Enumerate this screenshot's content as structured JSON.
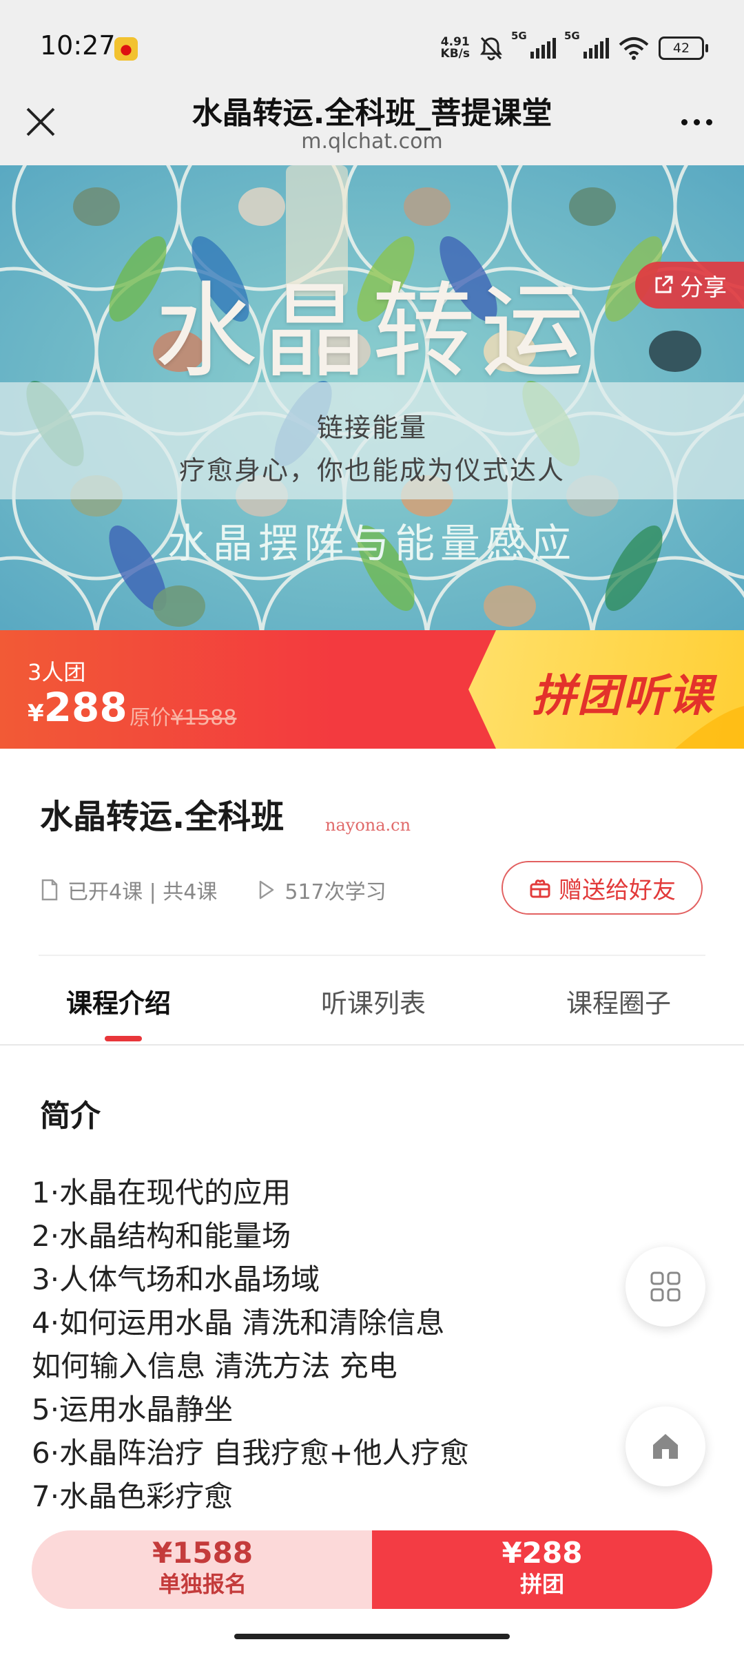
{
  "status_bar": {
    "time": "10:27",
    "net_speed_value": "4.91",
    "net_speed_unit": "KB/s",
    "sim1": "5G",
    "sim2": "5G",
    "battery": "42"
  },
  "title_bar": {
    "title": "水晶转运.全科班_菩提课堂",
    "url": "m.qlchat.com"
  },
  "banner": {
    "title": "水晶转运",
    "line1": "链接能量",
    "line2": "疗愈身心，你也能成为仪式达人",
    "subtitle": "水晶摆阵与能量感应",
    "share_label": "分享"
  },
  "price_strip": {
    "group_size": "3人团",
    "currency": "¥",
    "group_price": "288",
    "original_label": "原价",
    "original_price": "¥1588",
    "cta_label": "拼团听课"
  },
  "course": {
    "title": "水晶转运.全科班",
    "watermark": "nayona.cn",
    "lessons": "已开4课 | 共4课",
    "views": "517次学习",
    "gift_label": "赠送给好友"
  },
  "tabs": [
    {
      "label": "课程介绍",
      "active": true
    },
    {
      "label": "听课列表",
      "active": false
    },
    {
      "label": "课程圈子",
      "active": false
    }
  ],
  "intro": {
    "heading": "简介",
    "lines": [
      "1·水晶在现代的应用",
      "2·水晶结构和能量场",
      "3·人体气场和水晶场域",
      "4·如何运用水晶 清洗和清除信息",
      "如何输入信息 清洗方法 充电",
      "5·运用水晶静坐",
      "6·水晶阵治疗 自我疗愈+他人疗愈",
      "7·水晶色彩疗愈"
    ]
  },
  "bottom_bar": {
    "solo_price": "¥1588",
    "solo_label": "单独报名",
    "group_price": "¥288",
    "group_label": "拼团"
  },
  "colors": {
    "accent_red": "#f33c44",
    "cta_yellow": "#ffd43b",
    "solo_pink": "#fcd9d9"
  }
}
